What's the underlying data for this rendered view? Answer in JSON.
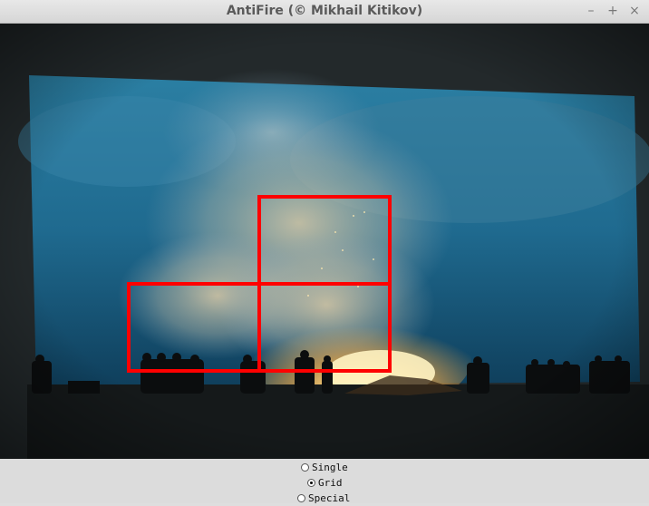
{
  "window": {
    "title": "AntiFire (© Mikhail Kitikov)",
    "buttons": {
      "minimize": "–",
      "maximize": "+",
      "close": "×"
    }
  },
  "video": {
    "scene": "crowd-silhouettes-bonfire-smoke",
    "overlay_color": "#ff0000",
    "detection_grid_cells": [
      {
        "row": 0,
        "col": 1
      },
      {
        "row": 1,
        "col": 0
      },
      {
        "row": 1,
        "col": 1
      }
    ]
  },
  "mode_selector": {
    "options": [
      {
        "label": "Single",
        "checked": false
      },
      {
        "label": "Grid",
        "checked": true
      },
      {
        "label": "Special",
        "checked": false
      }
    ]
  }
}
